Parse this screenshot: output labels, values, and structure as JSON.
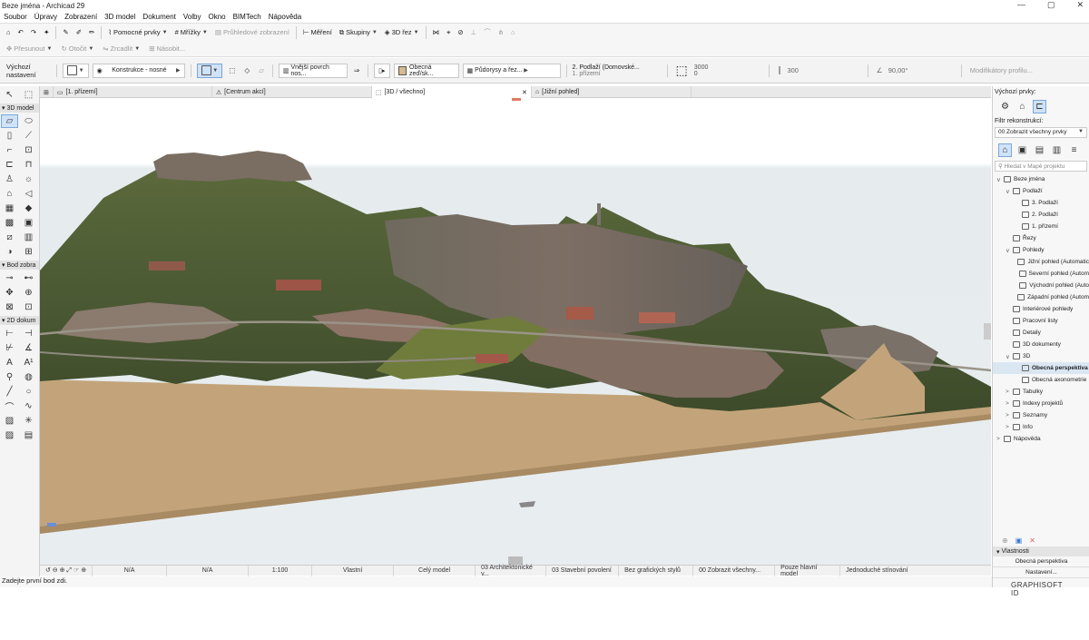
{
  "window": {
    "title": "Beze jména - Archicad 29",
    "controls": [
      "—",
      "▢",
      "✕"
    ]
  },
  "menu": [
    "Soubor",
    "Úpravy",
    "Zobrazení",
    "3D model",
    "Dokument",
    "Volby",
    "Okno",
    "BIMTech",
    "Nápověda"
  ],
  "toolbar1": {
    "pomocne": "Pomocné prvky",
    "mrizky": "Mřížky",
    "pruhledove": "Průhledové zobrazení",
    "mereni": "Měření",
    "skupiny": "Skupiny",
    "rez": "3D řez"
  },
  "toolbar2": {
    "presunout": "Přesunout",
    "otocit": "Otočit",
    "zrcadlit": "Zrcadlit",
    "nasobit": "Násobit..."
  },
  "infobox": {
    "vychozi": "Výchozí nastavení",
    "konstrukce": "Konstrukce - nosné",
    "povrch": "Vnější povrch nos...",
    "stena": "Obecná zeď/sk...",
    "pudorys": "Půdorysy a řez...",
    "podlazi1": "2. Podlaží (Domovské...",
    "podlazi2": "1. přízemí",
    "vyska": "3000",
    "offset": "0",
    "tloustka": "300",
    "uhel": "90,00°",
    "modifikatory": "Modifikátory profilu..."
  },
  "tabs": [
    "[1. přízemí]",
    "[Centrum akcí]",
    "[3D / všechno]",
    "[Jižní pohled]"
  ],
  "left_sections": {
    "model": "3D model",
    "bod": "Bod zobra",
    "dok": "2D dokum"
  },
  "status_bar": [
    "N/A",
    "N/A",
    "1:100",
    "Vlastní",
    "Celý model",
    "03 Architektonické v...",
    "03 Stavební povolení",
    "Bez grafických stylů",
    "00 Zobrazit všechny...",
    "Pouze hlavní model",
    "Jednoduché stínování"
  ],
  "hint": "Zadejte první bod zdi.",
  "right_panel": {
    "vychozi_prvky": "Výchozí prvky:",
    "filtr_label": "Filtr rekonstrukcí:",
    "filtr_value": "00 Zobrazit všechny prvky",
    "search_placeholder": "Hledat v Mapě projektu",
    "tree": [
      {
        "label": "Beze jména",
        "level": 0,
        "arrow": "∨"
      },
      {
        "label": "Podlaží",
        "level": 1,
        "arrow": "∨"
      },
      {
        "label": "3. Podlaží",
        "level": 2,
        "arrow": ""
      },
      {
        "label": "2. Podlaží",
        "level": 2,
        "arrow": ""
      },
      {
        "label": "1. přízemí",
        "level": 2,
        "arrow": ""
      },
      {
        "label": "Řezy",
        "level": 1,
        "arrow": ""
      },
      {
        "label": "Pohledy",
        "level": 1,
        "arrow": "∨"
      },
      {
        "label": "Jižní pohled (Automatic",
        "level": 2,
        "arrow": ""
      },
      {
        "label": "Severní pohled (Autom",
        "level": 2,
        "arrow": ""
      },
      {
        "label": "Východní pohled (Auto",
        "level": 2,
        "arrow": ""
      },
      {
        "label": "Západní pohled (Autom",
        "level": 2,
        "arrow": ""
      },
      {
        "label": "Interiérové pohledy",
        "level": 1,
        "arrow": ""
      },
      {
        "label": "Pracovní listy",
        "level": 1,
        "arrow": ""
      },
      {
        "label": "Detaily",
        "level": 1,
        "arrow": ""
      },
      {
        "label": "3D dokumenty",
        "level": 1,
        "arrow": ""
      },
      {
        "label": "3D",
        "level": 1,
        "arrow": "∨"
      },
      {
        "label": "Obecná perspektiva",
        "level": 2,
        "arrow": "",
        "selected": true
      },
      {
        "label": "Obecná axonometrie",
        "level": 2,
        "arrow": ""
      },
      {
        "label": "Tabulky",
        "level": 1,
        "arrow": ">"
      },
      {
        "label": "Indexy projektů",
        "level": 1,
        "arrow": ">"
      },
      {
        "label": "Seznamy",
        "level": 1,
        "arrow": ">"
      },
      {
        "label": "Info",
        "level": 1,
        "arrow": ">"
      },
      {
        "label": "Nápověda",
        "level": 0,
        "arrow": ">"
      }
    ],
    "vlastnosti": "Vlastnosti",
    "vlastnosti_value": "Obecná perspektiva",
    "nastaveni": "Nastavení...",
    "brand": "GRAPHISOFT ID"
  },
  "colors": {
    "ground": "#c3a47a",
    "sky": "#e9eef0",
    "accent": "#3a7bd5"
  }
}
